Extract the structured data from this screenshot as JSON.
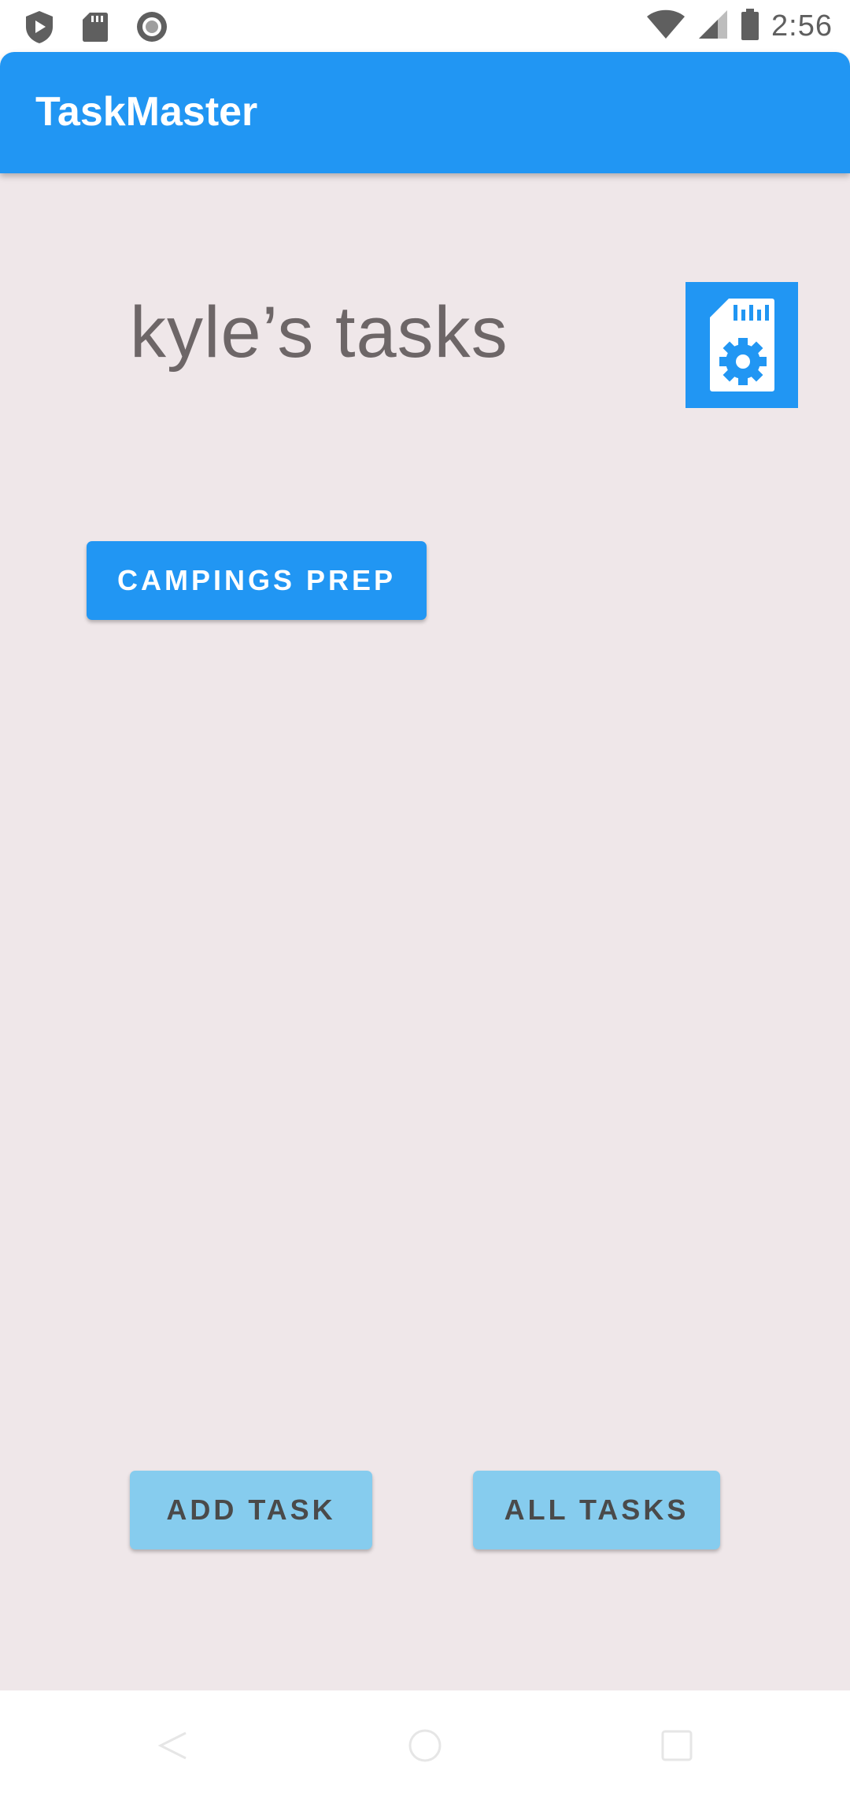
{
  "status_bar": {
    "time": "2:56",
    "left_icons": [
      "shield-play-icon",
      "sd-card-icon",
      "record-circle-icon"
    ],
    "right_icons": [
      "wifi-icon",
      "cell-signal-icon",
      "battery-icon"
    ]
  },
  "app_bar": {
    "title": "TaskMaster"
  },
  "main": {
    "heading": "kyle’s tasks",
    "settings_icon": "sd-card-settings-icon",
    "task_buttons": [
      {
        "label": "CAMPINGS PREP"
      }
    ],
    "actions": {
      "add_task_label": "ADD TASK",
      "all_tasks_label": "ALL TASKS"
    }
  },
  "nav_bar": {
    "icons": [
      "back-icon",
      "home-icon",
      "recents-icon"
    ]
  },
  "colors": {
    "primary": "#2196F3",
    "secondary_button": "#86CCEE",
    "background": "#EFE7E9",
    "heading_text": "#6d6667"
  }
}
